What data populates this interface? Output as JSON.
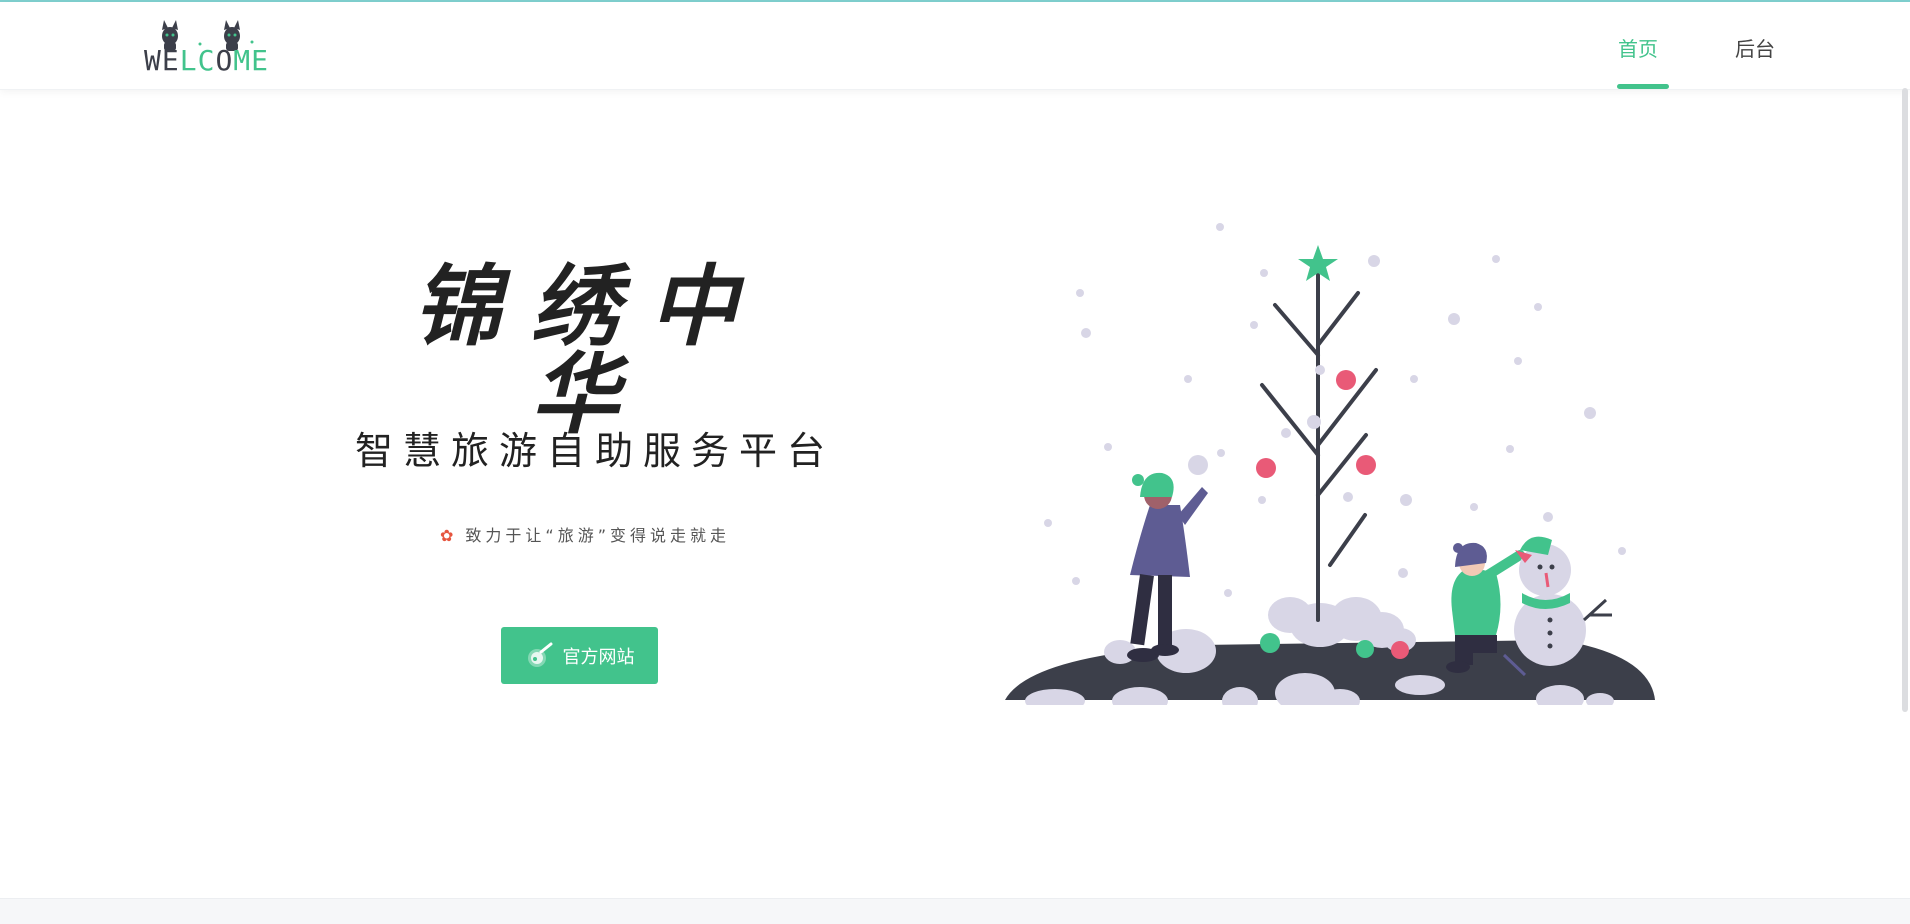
{
  "logo": {
    "text_dark": [
      "W",
      "E"
    ],
    "text_green": [
      "L",
      "C"
    ],
    "text_dark2": [
      "O"
    ],
    "text_green2": [
      "M",
      "E"
    ],
    "full_text": "WELCOME"
  },
  "nav": {
    "home": "首页",
    "admin": "后台"
  },
  "hero": {
    "title": "锦绣中华",
    "subtitle": "智慧旅游自助服务平台",
    "tagline": "致力于让“旅游”变得说走就走",
    "tagline_icon": "flower-icon",
    "cta_label": "官方网站",
    "cta_icon": "comet-icon"
  },
  "colors": {
    "accent": "#42c38c",
    "dark": "#3c3f4a",
    "berry": "#e95a77",
    "snow": "#d8d6e6"
  }
}
